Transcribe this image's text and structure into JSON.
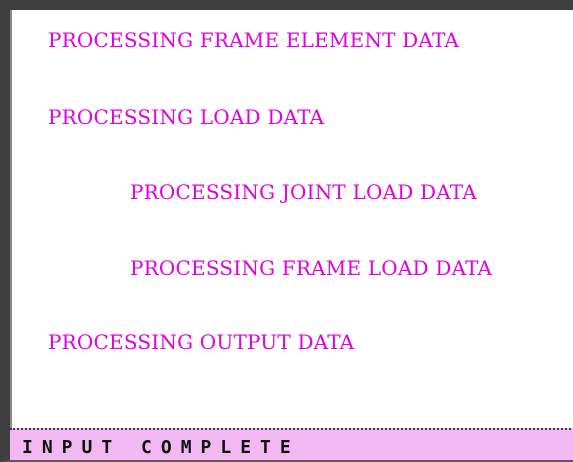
{
  "console": {
    "lines": [
      "PROCESSING FRAME ELEMENT DATA",
      "PROCESSING LOAD DATA",
      "PROCESSING JOINT LOAD DATA",
      "PROCESSING FRAME LOAD DATA",
      "PROCESSING OUTPUT DATA"
    ],
    "text_color": "#e000e0"
  },
  "status_bar": {
    "text": "INPUT  COMPLETE",
    "background": "#f2b8f2"
  }
}
